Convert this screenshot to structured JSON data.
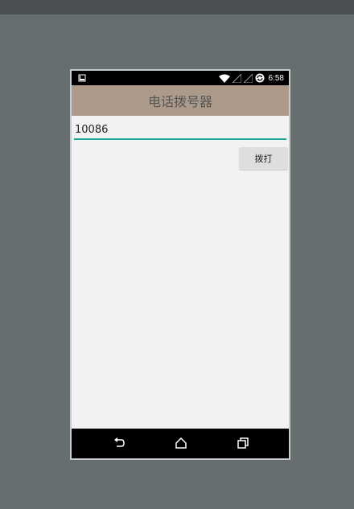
{
  "status_bar": {
    "time": "6:58",
    "icons": [
      "notification-icon",
      "wifi-icon",
      "signal-empty-icon",
      "signal-empty-icon",
      "sync-icon"
    ]
  },
  "app_bar": {
    "title": "电话拨号器"
  },
  "form": {
    "phone_value": "10086",
    "dial_label": "拨打"
  },
  "nav_bar": {
    "icons": [
      "back-icon",
      "home-icon",
      "recents-icon"
    ]
  },
  "colors": {
    "app_bar": "#ac9a8a",
    "input_underline": "#26a99a",
    "background": "#676e70"
  }
}
